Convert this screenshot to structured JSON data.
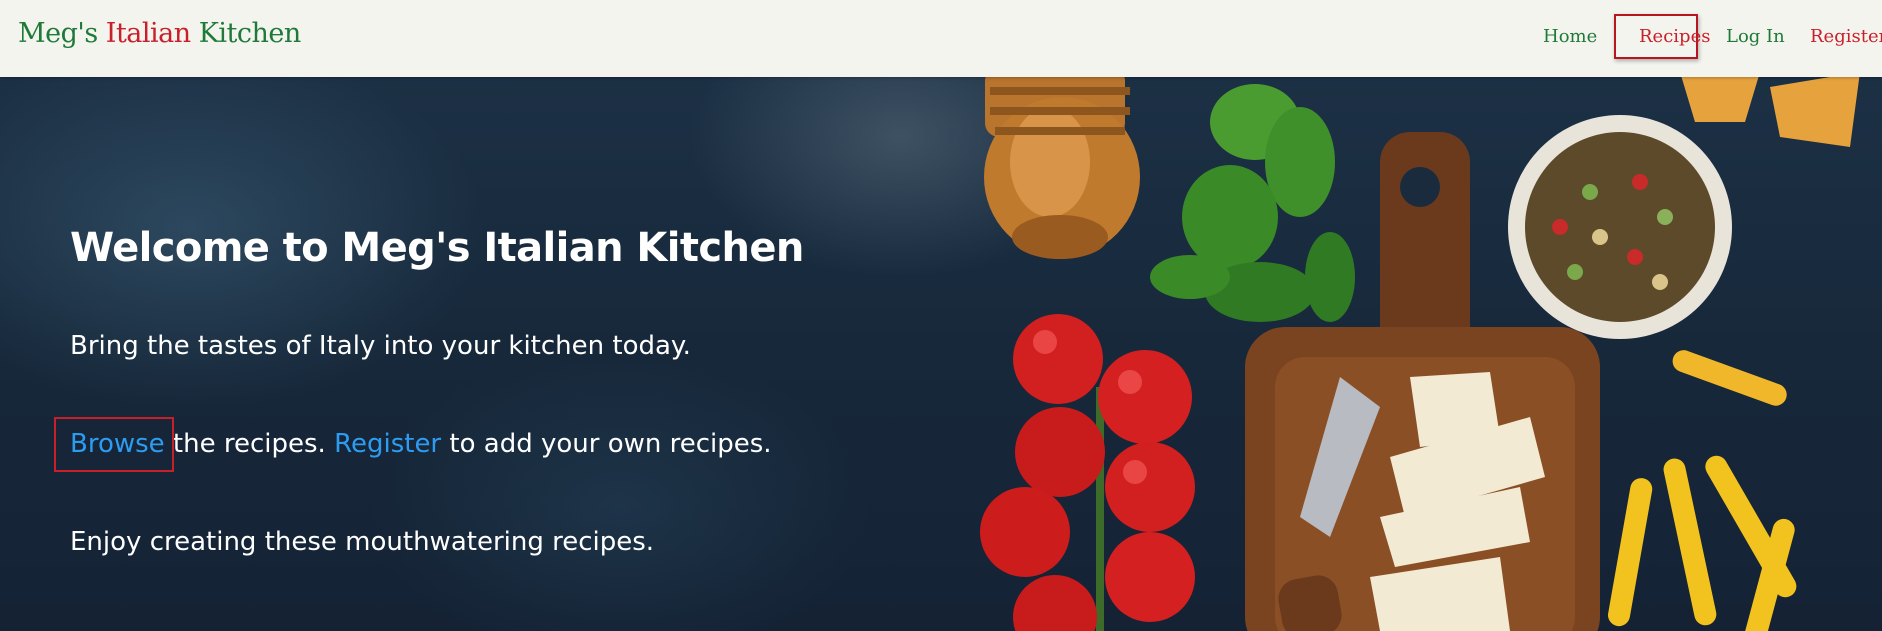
{
  "navbar": {
    "brand": {
      "part1": "Meg's ",
      "part2": "Italian",
      "part3": " Kitchen"
    },
    "links": {
      "home": "Home",
      "recipes": "Recipes",
      "login": "Log In",
      "register": "Register"
    }
  },
  "hero": {
    "title": "Welcome to Meg's Italian Kitchen",
    "subtitle": "Bring the tastes of Italy into your kitchen today.",
    "browse_link": "Browse",
    "browse_rest": " the recipes. ",
    "register_link": "Register",
    "register_rest": " to add your own recipes.",
    "enjoy": "Enjoy creating these mouthwatering recipes."
  },
  "colors": {
    "brand_green": "#1f7a3a",
    "brand_red": "#c8202a",
    "link_blue": "#2d9cf0",
    "nav_bg": "#f4f4ef"
  }
}
